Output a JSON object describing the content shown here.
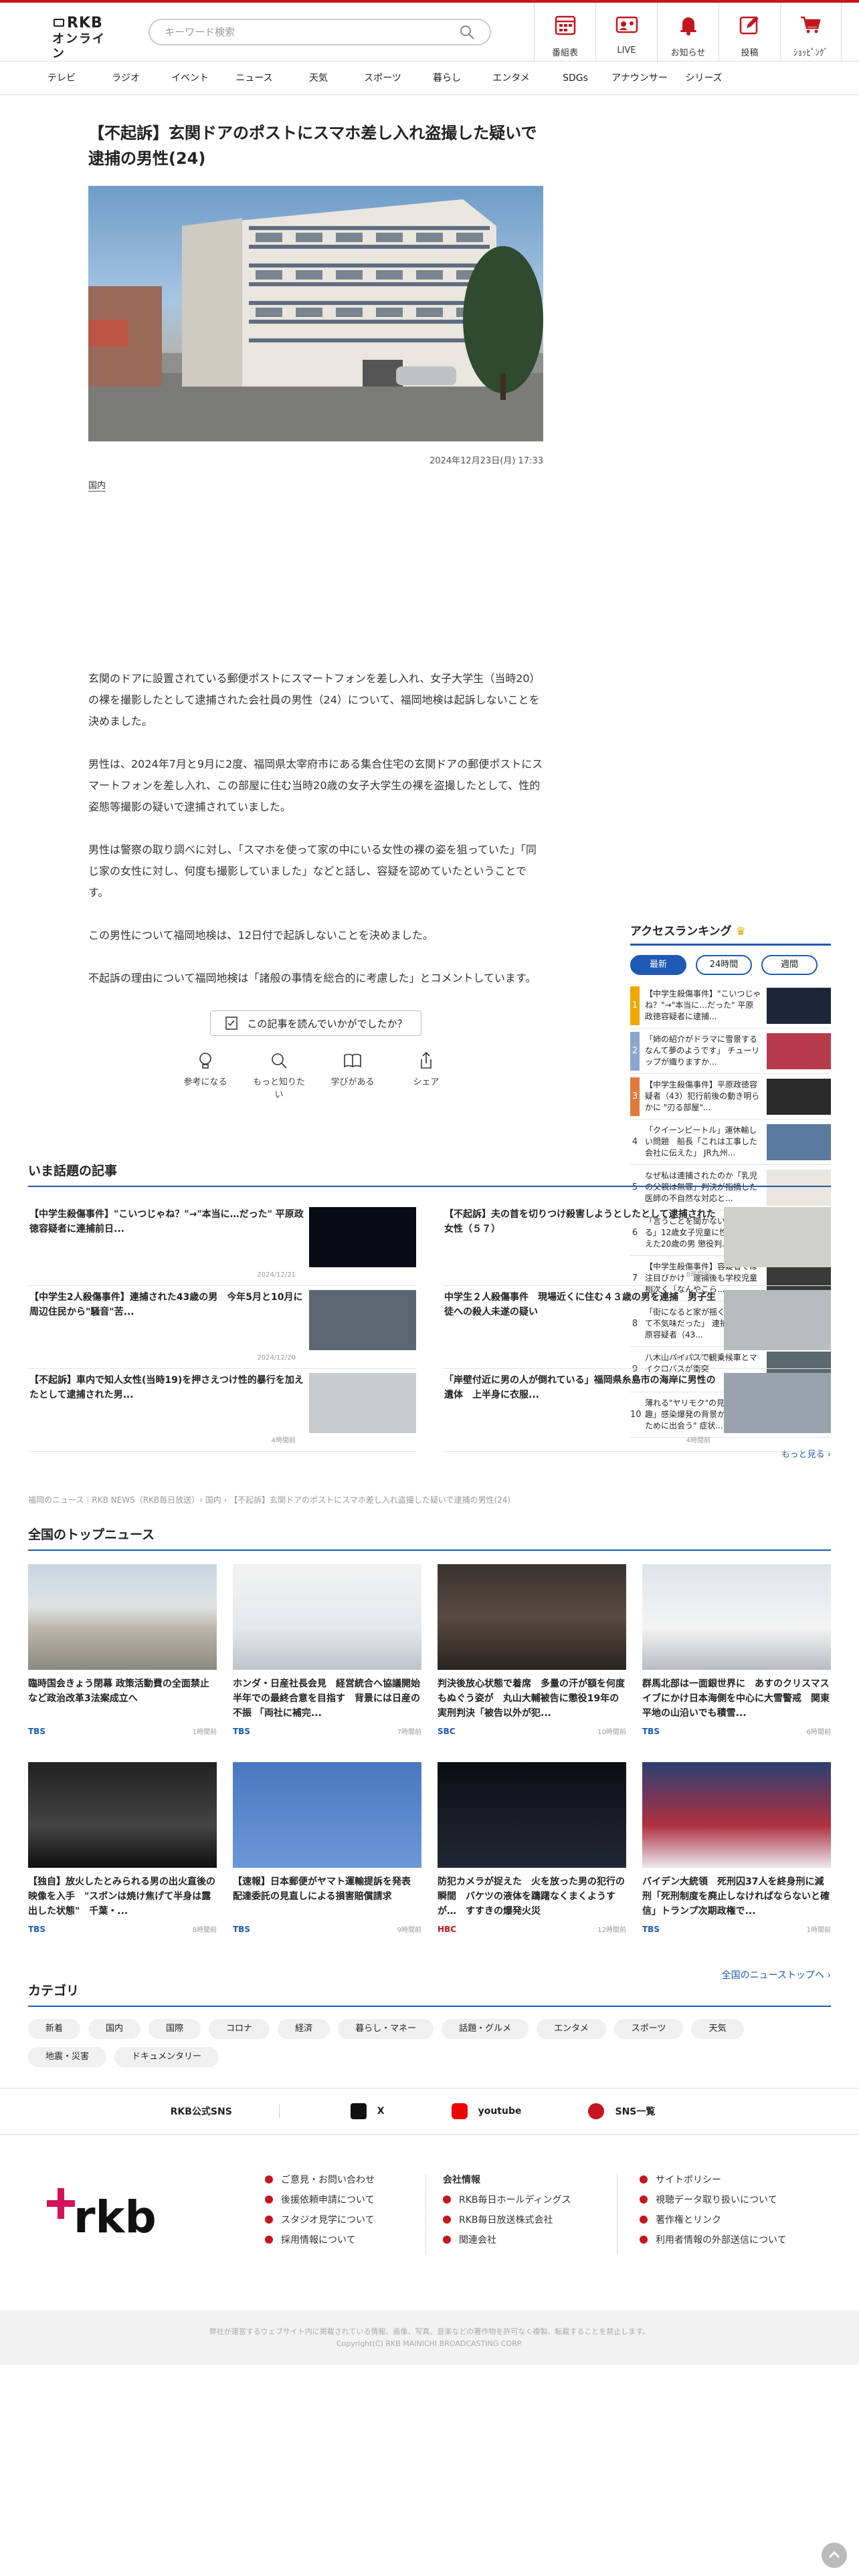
{
  "header": {
    "logo_line1": "RKB",
    "logo_line2": "オンライン",
    "search_placeholder": "キーワード検索",
    "icons": [
      {
        "label": "番組表",
        "icon": "calendar-icon"
      },
      {
        "label": "LIVE",
        "icon": "live-icon"
      },
      {
        "label": "お知らせ",
        "icon": "bell-icon"
      },
      {
        "label": "投稿",
        "icon": "post-icon"
      },
      {
        "label": "ｼｮｯﾋﾟﾝｸﾞ",
        "icon": "cart-icon"
      }
    ],
    "accent": "#c4161c"
  },
  "nav": [
    "テレビ",
    "ラジオ",
    "イベント",
    "ニュース",
    "天気",
    "スポーツ",
    "暮らし",
    "エンタメ",
    "SDGs",
    "アナウンサー",
    "シリーズ"
  ],
  "article": {
    "title": "【不起訴】玄関ドアのポストにスマホ差し入れ盗撮した疑いで逮捕の男性(24)",
    "date": "2024年12月23日(月) 17:33",
    "tag": "国内",
    "paragraphs": [
      "玄関のドアに設置されている郵便ポストにスマートフォンを差し入れ、女子大学生（当時20）の裸を撮影したとして逮捕された会社員の男性（24）について、福岡地検は起訴しないことを決めました。",
      "男性は、2024年7月と9月に2度、福岡県太宰府市にある集合住宅の玄関ドアの郵便ポストにスマートフォンを差し入れ、この部屋に住む当時20歳の女子大学生の裸を盗撮したとして、性的姿態等撮影の疑いで逮捕されていました。",
      "男性は警察の取り調べに対し、「スマホを使って家の中にいる女性の裸の姿を狙っていた」「同じ家の女性に対し、何度も撮影していました」などと話し、容疑を認めていたということです。",
      "この男性について福岡地検は、12日付で起訴しないことを決めました。",
      "不起訴の理由について福岡地検は「諸般の事情を総合的に考慮した」とコメントしています。"
    ],
    "reaction_question": "この記事を読んでいかがでしたか？",
    "reactions": [
      {
        "label": "参考になる",
        "icon": "bulb-icon"
      },
      {
        "label": "もっと知りたい",
        "icon": "magnifier-icon"
      },
      {
        "label": "学びがある",
        "icon": "book-icon"
      },
      {
        "label": "シェア",
        "icon": "share-icon"
      }
    ]
  },
  "ranking": {
    "title": "アクセスランキング",
    "tabs": [
      "最新",
      "24時間",
      "週間"
    ],
    "items": [
      {
        "rank": "1",
        "text": "【中学生殺傷事件】\"こいつじゃね？\"→\"本当に…だった\" 平原政徳容疑者に逮捕..."
      },
      {
        "rank": "2",
        "text": "「姉の紹介がドラマに雪景するなんて夢のようです」 チューリップが織りますか..."
      },
      {
        "rank": "3",
        "text": "【中学生殺傷事件】平原政徳容疑者（43）犯行前後の動き明らかに \"刃る部屋\"..."
      },
      {
        "rank": "4",
        "text": "「クイーンビートル」運休輸しい問題　船長「これは工事した会社に伝えた」 JR九州..."
      },
      {
        "rank": "5",
        "text": "なぜ私は連捕されたのか「乳児の父親は無罪」判決が指摘した　医師の不自然な対応と..."
      },
      {
        "rank": "6",
        "text": "「言うことを聞かないと殺される」12歳女子児童に性的暴行加えた20歳の男 懲役判..."
      },
      {
        "rank": "7",
        "text": "【中学生殺傷事件】容疑者では注目びかけ　連捕後も学校児童相次く「なんやこら..."
      },
      {
        "rank": "8",
        "text": "「街になると家が揺く斤っていて不気味だった」 連捕された平原容疑者（43..."
      },
      {
        "rank": "9",
        "text": "八木山バイパスで観乗候車とマイクロバスが衝突"
      },
      {
        "rank": "10",
        "text": "薄れる\"ヤリモク\"の見抗感、「褒趣」感染爆発の背景か？ \"やるために出会う\" 症状..."
      }
    ],
    "more": "もっと見る ›"
  },
  "hot": {
    "title": "いま話題の記事",
    "items": [
      {
        "text": "【中学生殺傷事件】\"こいつじゃね？\"→\"本当に…だった\" 平原政徳容疑者に連捕前日...",
        "time": "2024/12/21"
      },
      {
        "text": "【不起訴】夫の首を切りつけ殺害しようとしたとして逮捕された女性（５７）",
        "time": "8時間前"
      },
      {
        "text": "【中学生2人殺傷事件】連捕された43歳の男　今年5月と10月に周辺住民から\"騒音\"苦...",
        "time": "2024/12/20"
      },
      {
        "text": "中学生２人殺傷事件　現場近くに住む４３歳の男を連捕　男子生徒への殺人未遂の疑い",
        "time": "2024/12/19"
      },
      {
        "text": "【不起訴】車内で知人女性(当時19)を押さえつけ性的暴行を加えたとして逮捕された男...",
        "time": "4時間前"
      },
      {
        "text": "「岸壁付近に男の人が倒れている」福岡県糸島市の海岸に男性の遺体　上半身に衣服...",
        "time": "4時間前"
      }
    ]
  },
  "breadcrumb": "福岡のニュース｜RKB NEWS（RKB毎日放送）› 国内 › 【不起訴】玄関ドアのポストにスマホ差し入れ盗撮した疑いで逮捕の男性(24)",
  "topnews": {
    "title": "全国のトップニュース",
    "items": [
      {
        "text": "臨時国会きょう閉幕 政策活動費の全面禁止など政治改革3法案成立へ",
        "src": "TBS",
        "time": "1時間前",
        "srccolor": "#1e59b6"
      },
      {
        "text": "ホンダ・日産社長会見　経営統合へ協議開始　半年での最終合意を目指す　背景には日産の不振 「両社に補完...",
        "src": "TBS",
        "time": "7時間前",
        "srccolor": "#1e59b6"
      },
      {
        "text": "判決後放心状態で着席　多量の汗が額を何度もぬぐう姿が　丸山大輔被告に懲役19年の実刑判決「被告以外が犯...",
        "src": "SBC",
        "time": "10時間前",
        "srccolor": "#1e59b6"
      },
      {
        "text": "群馬北部は一面銀世界に　あすのクリスマスイブにかけ日本海側を中心に大雪警戒　関東平地の山沿いでも積雪...",
        "src": "TBS",
        "time": "6時間前",
        "srccolor": "#1e59b6"
      },
      {
        "text": "【独自】放火したとみられる男の出火直後の映像を入手　\"スボンは焼け焦げて半身は露出した状態\"　千葉・...",
        "src": "TBS",
        "time": "8時間前",
        "srccolor": "#1e59b6"
      },
      {
        "text": "【速報】日本郵便がヤマト運輸提訴を発表　配達委託の見直しによる損害賠償請求",
        "src": "TBS",
        "time": "9時間前",
        "srccolor": "#1e59b6"
      },
      {
        "text": "防犯カメラが捉えた　火を放った男の犯行の瞬間　バケツの液体を躊躇なくまくようすが…　すすきの爆発火災",
        "src": "HBC",
        "time": "12時間前",
        "srccolor": "#c4161c"
      },
      {
        "text": "バイデン大統領　死刑囚37人を終身刑に減刑「死刑制度を廃止しなければならないと確信」トランプ次期政権で...",
        "src": "TBS",
        "time": "1時間前",
        "srccolor": "#1e59b6"
      }
    ],
    "more": "全国のニューストップへ ›"
  },
  "category": {
    "title": "カテゴリ",
    "items": [
      "新着",
      "国内",
      "国際",
      "コロナ",
      "経済",
      "暮らし・マネー",
      "話題・グルメ",
      "エンタメ",
      "スポーツ",
      "天気",
      "地震・災害",
      "ドキュメンタリー"
    ]
  },
  "sns": {
    "label": "RKB公式SNS",
    "items": [
      {
        "label": "X",
        "icon": "x-icon"
      },
      {
        "label": "youtube",
        "icon": "youtube-icon"
      },
      {
        "label": "SNS一覧",
        "icon": "sns-icon"
      }
    ]
  },
  "footer": {
    "logo": "rkb",
    "col1": [
      "ご意見・お問い合わせ",
      "後援依頼申請について",
      "スタジオ見学について",
      "採用情報について"
    ],
    "col2_head": "会社情報",
    "col2": [
      "RKB毎日ホールディングス",
      "RKB毎日放送株式会社",
      "関連会社"
    ],
    "col3": [
      "サイトポリシー",
      "視聴データ取り扱いについて",
      "著作権とリンク",
      "利用者情報の外部送信について"
    ],
    "copy1": "弊社が運営するウェブサイト内に掲載されている情報、画像、写真、音楽などの著作物を許可なく複製、転載することを禁止します。",
    "copy2": "Copyright(C) RKB MAINICHI BROADCASTING CORP."
  }
}
